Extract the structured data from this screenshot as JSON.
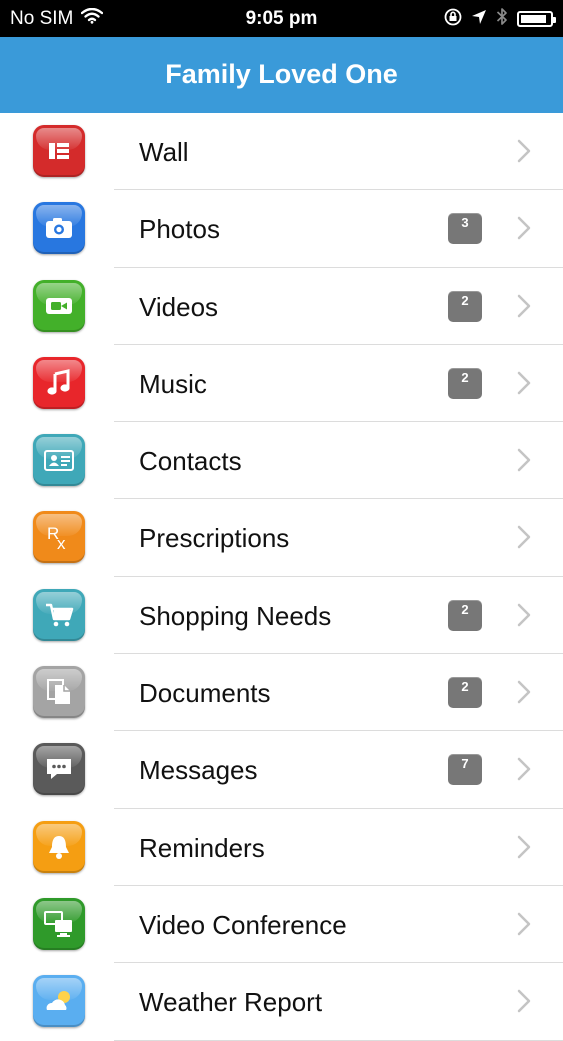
{
  "status": {
    "carrier": "No SIM",
    "time": "9:05 pm",
    "battery_level": 0.9
  },
  "nav": {
    "title": "Family Loved One"
  },
  "items": [
    {
      "label": "Wall",
      "badge": "",
      "icon": "wall-icon",
      "color": "#d42b2b"
    },
    {
      "label": "Photos",
      "badge": "3",
      "icon": "camera-icon",
      "color": "#2877e0"
    },
    {
      "label": "Videos",
      "badge": "2",
      "icon": "video-camera-icon",
      "color": "#43b02a"
    },
    {
      "label": "Music",
      "badge": "2",
      "icon": "music-note-icon",
      "color": "#e8262b"
    },
    {
      "label": "Contacts",
      "badge": "",
      "icon": "contact-card-icon",
      "color": "#3fa8b8"
    },
    {
      "label": "Prescriptions",
      "badge": "",
      "icon": "rx-icon",
      "color": "#f08a1a"
    },
    {
      "label": "Shopping Needs",
      "badge": "2",
      "icon": "shopping-cart-icon",
      "color": "#3fa8b8"
    },
    {
      "label": "Documents",
      "badge": "2",
      "icon": "documents-icon",
      "color": "#a4a4a4"
    },
    {
      "label": "Messages",
      "badge": "7",
      "icon": "message-bubble-icon",
      "color": "#5a5a5a"
    },
    {
      "label": "Reminders",
      "badge": "",
      "icon": "bell-icon",
      "color": "#f59e12"
    },
    {
      "label": "Video Conference",
      "badge": "",
      "icon": "video-conference-icon",
      "color": "#2f9a2a"
    },
    {
      "label": "Weather Report",
      "badge": "",
      "icon": "weather-icon",
      "color": "#5aaef0"
    }
  ]
}
